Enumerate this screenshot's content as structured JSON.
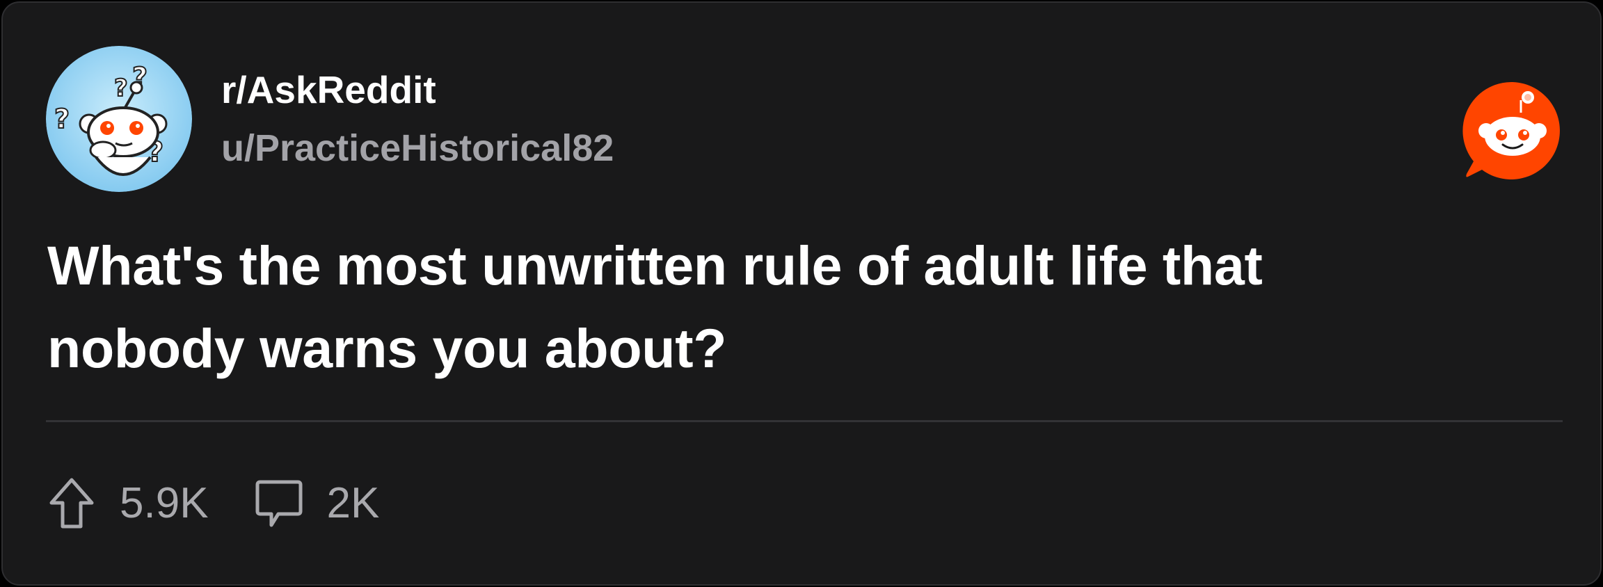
{
  "post": {
    "subreddit": "r/AskReddit",
    "author": "u/PracticeHistorical82",
    "title": "What's the most unwritten rule of adult life that nobody warns you about?",
    "upvotes": "5.9K",
    "comments": "2K"
  },
  "icons": {
    "avatar": "askreddit-snoo-avatar",
    "brand": "reddit-logo-icon",
    "upvote": "upvote-arrow-icon",
    "comment": "comment-bubble-icon"
  },
  "colors": {
    "card_background": "#19191a",
    "card_border": "#2e2e31",
    "primary_text": "#ffffff",
    "secondary_text": "#a3a3a8",
    "reddit_orange": "#ff4500",
    "avatar_background": "#8fd0f2"
  }
}
